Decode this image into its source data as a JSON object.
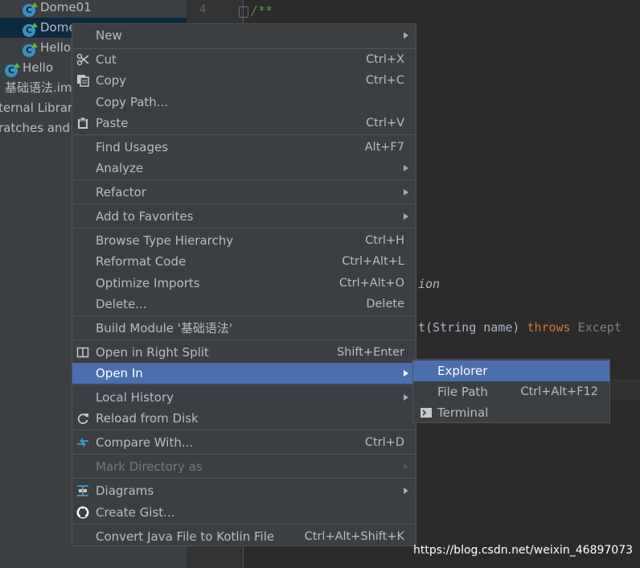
{
  "project_tree": {
    "items": [
      {
        "label": "Dome01"
      },
      {
        "label": "Dome"
      },
      {
        "label": "Hello"
      },
      {
        "label": "Hello"
      },
      {
        "label": "基础语法.im"
      },
      {
        "label": "ternal Librar"
      },
      {
        "label": "ratches and"
      }
    ]
  },
  "editor": {
    "line_number": "4",
    "comment_open": "/**",
    "fragment_ion": "ion",
    "sig_t": "t(String name) ",
    "sig_throws": "throws",
    "sig_except": " Except"
  },
  "context_menu": {
    "items": [
      {
        "label": "New",
        "shortcut": "",
        "icon": "",
        "submenu": true
      },
      {
        "label": "Cut",
        "shortcut": "Ctrl+X",
        "icon": "scissors-icon",
        "submenu": false
      },
      {
        "label": "Copy",
        "shortcut": "Ctrl+C",
        "icon": "copy-icon",
        "submenu": false
      },
      {
        "label": "Copy Path...",
        "shortcut": "",
        "icon": "",
        "submenu": false
      },
      {
        "label": "Paste",
        "shortcut": "Ctrl+V",
        "icon": "clipboard-icon",
        "submenu": false
      },
      {
        "label": "Find Usages",
        "shortcut": "Alt+F7",
        "icon": "",
        "submenu": false
      },
      {
        "label": "Analyze",
        "shortcut": "",
        "icon": "",
        "submenu": true
      },
      {
        "label": "Refactor",
        "shortcut": "",
        "icon": "",
        "submenu": true
      },
      {
        "label": "Add to Favorites",
        "shortcut": "",
        "icon": "",
        "submenu": true
      },
      {
        "label": "Browse Type Hierarchy",
        "shortcut": "Ctrl+H",
        "icon": "",
        "submenu": false
      },
      {
        "label": "Reformat Code",
        "shortcut": "Ctrl+Alt+L",
        "icon": "",
        "submenu": false
      },
      {
        "label": "Optimize Imports",
        "shortcut": "Ctrl+Alt+O",
        "icon": "",
        "submenu": false
      },
      {
        "label": "Delete...",
        "shortcut": "Delete",
        "icon": "",
        "submenu": false
      },
      {
        "label": "Build Module '基础语法'",
        "shortcut": "",
        "icon": "",
        "submenu": false
      },
      {
        "label": "Open in Right Split",
        "shortcut": "Shift+Enter",
        "icon": "split-icon",
        "submenu": false
      },
      {
        "label": "Open In",
        "shortcut": "",
        "icon": "",
        "submenu": true
      },
      {
        "label": "Local History",
        "shortcut": "",
        "icon": "",
        "submenu": true
      },
      {
        "label": "Reload from Disk",
        "shortcut": "",
        "icon": "reload-icon",
        "submenu": false
      },
      {
        "label": "Compare With...",
        "shortcut": "Ctrl+D",
        "icon": "compare-icon",
        "submenu": false
      },
      {
        "label": "Mark Directory as",
        "shortcut": "",
        "icon": "",
        "submenu": true
      },
      {
        "label": "Diagrams",
        "shortcut": "",
        "icon": "diagram-icon",
        "submenu": true
      },
      {
        "label": "Create Gist...",
        "shortcut": "",
        "icon": "github-icon",
        "submenu": false
      },
      {
        "label": "Convert Java File to Kotlin File",
        "shortcut": "Ctrl+Alt+Shift+K",
        "icon": "",
        "submenu": false
      }
    ],
    "active_item": "Open In",
    "disabled_item": "Mark Directory as"
  },
  "submenu": {
    "items": [
      {
        "label": "Explorer",
        "shortcut": ""
      },
      {
        "label": "File Path",
        "shortcut": "Ctrl+Alt+F12"
      },
      {
        "label": "Terminal",
        "shortcut": "",
        "icon": "terminal-icon"
      }
    ],
    "active_item": "Explorer"
  },
  "watermark": "https://blog.csdn.net/weixin_46897073",
  "colors": {
    "menu_bg": "#3c3f41",
    "highlight": "#4b6eaf",
    "editor_bg": "#2b2b2b",
    "keyword": "#cc7832",
    "comment": "#629755"
  }
}
